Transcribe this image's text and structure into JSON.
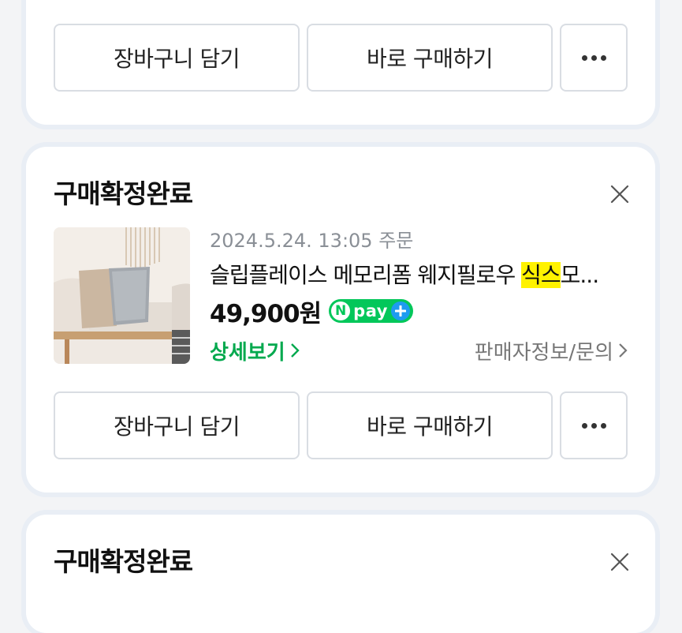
{
  "top_card": {
    "cart_button": "장바구니 담기",
    "buy_button": "바로 구매하기"
  },
  "order": {
    "status": "구매확정완료",
    "date": "2024.5.24. 13:05 주문",
    "title_prefix": "슬립플레이스 메모리폼 웨지필로우 ",
    "title_highlight": "식스",
    "title_suffix": "모...",
    "price": "49,900원",
    "npay_n": "N",
    "npay_label": "pay",
    "detail_link": "상세보기",
    "seller_link": "판매자정보/문의",
    "cart_button": "장바구니 담기",
    "buy_button": "바로 구매하기"
  },
  "bottom_card": {
    "status": "구매확정완료"
  },
  "colors": {
    "accent_green": "#03c75a",
    "highlight": "#fff200"
  },
  "icons": [
    "more-icon",
    "close-icon",
    "chevron-right-icon",
    "plus-icon"
  ]
}
